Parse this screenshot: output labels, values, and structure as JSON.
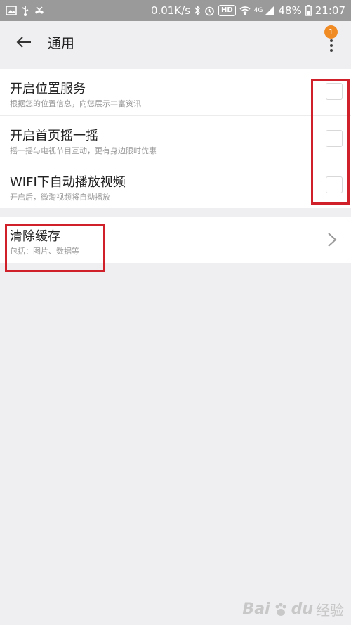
{
  "status_bar": {
    "speed": "0.01K/s",
    "hd": "HD",
    "network": "4G",
    "battery": "48%",
    "time": "21:07",
    "icons": [
      "image-icon",
      "usb-icon",
      "missed-call-icon",
      "bluetooth-icon",
      "alarm-icon",
      "wifi-icon",
      "signal-icon",
      "battery-icon"
    ]
  },
  "header": {
    "title": "通用",
    "back_icon": "arrow-left-icon",
    "more_icon": "more-vertical-icon",
    "notification_count": "1",
    "badge_color": "#f08a22"
  },
  "settings": {
    "items": [
      {
        "title": "开启位置服务",
        "subtitle": "根据您的位置信息，向您展示丰富资讯",
        "checked": false
      },
      {
        "title": "开启首页摇一摇",
        "subtitle": "摇一摇与电视节目互动，更有身边限时优惠",
        "checked": false
      },
      {
        "title": "WIFI下自动播放视频",
        "subtitle": "开启后，微淘视频将自动播放",
        "checked": false
      }
    ]
  },
  "cache": {
    "title": "清除缓存",
    "subtitle": "包括：图片、数据等",
    "chevron_icon": "chevron-right-icon"
  },
  "annotation_color": "#d0212a",
  "watermark": {
    "brand": "Bai",
    "brand_end": "du",
    "sub": "经验"
  }
}
